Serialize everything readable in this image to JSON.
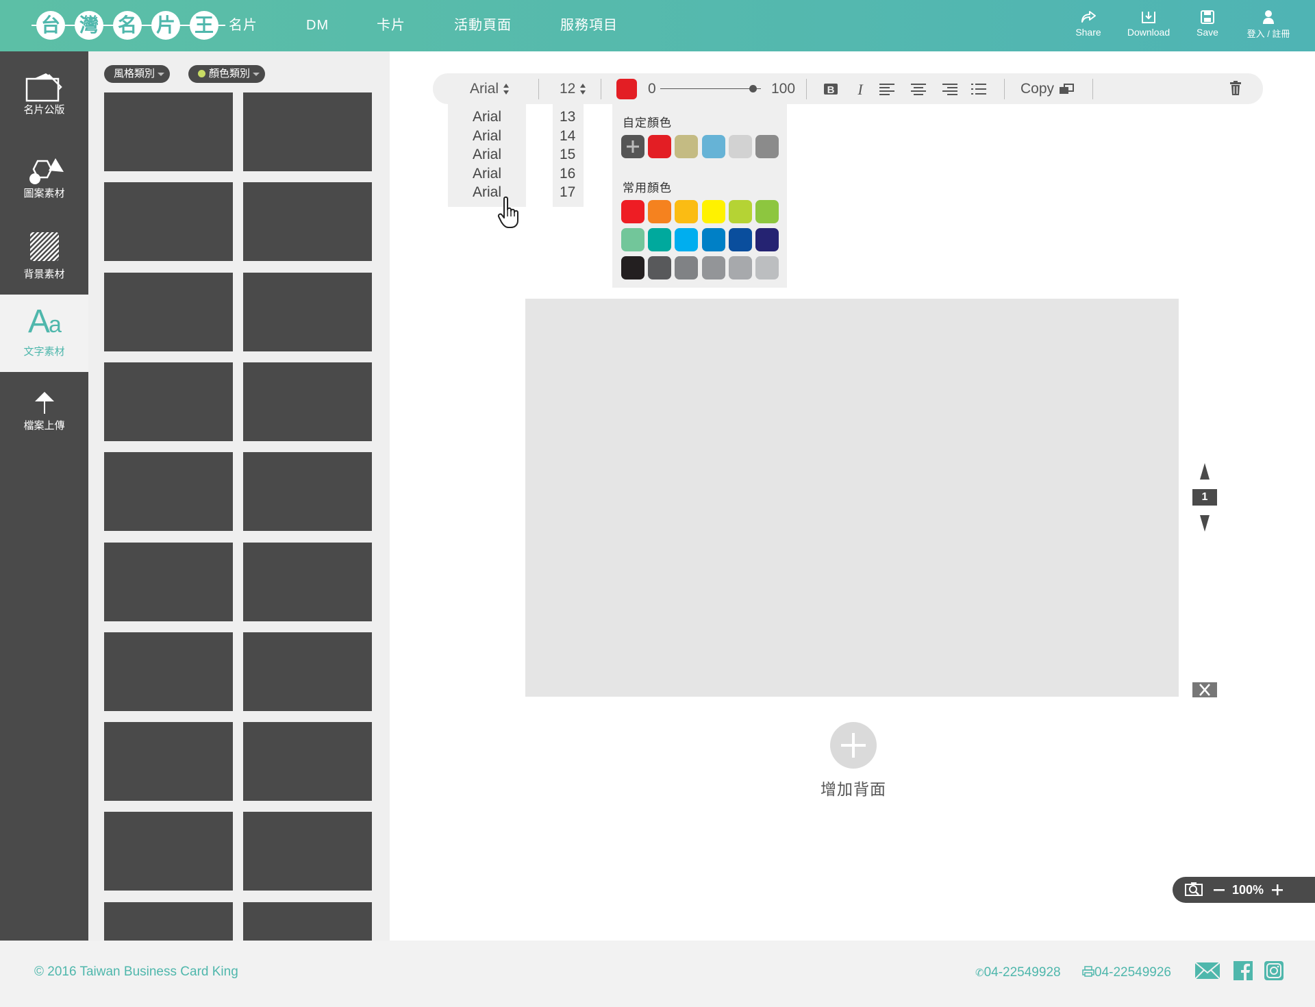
{
  "header": {
    "logo_chars": [
      "台",
      "灣",
      "名",
      "片",
      "王"
    ],
    "nav": [
      "名片",
      "DM",
      "卡片",
      "活動頁面",
      "服務項目"
    ],
    "actions": {
      "share": "Share",
      "download": "Download",
      "save": "Save",
      "login": "登入 / 註冊"
    }
  },
  "sidebar": {
    "items": [
      {
        "label": "名片公版",
        "icon": "card-template-icon"
      },
      {
        "label": "圖案素材",
        "icon": "shapes-icon"
      },
      {
        "label": "背景素材",
        "icon": "background-pattern-icon"
      },
      {
        "label": "文字素材",
        "icon": "text-aa-icon",
        "active": true
      },
      {
        "label": "檔案上傳",
        "icon": "upload-arrow-icon"
      }
    ]
  },
  "panel": {
    "style_filter": "風格類別",
    "color_filter": "顏色類別",
    "thumbnail_count": 20
  },
  "toolbar": {
    "font": "Arial",
    "size": "12",
    "color": "#e31e24",
    "opacity_min": "0",
    "opacity_max": "100",
    "copy_label": "Copy"
  },
  "font_dropdown": [
    "Arial",
    "Arial",
    "Arial",
    "Arial",
    "Arial"
  ],
  "size_dropdown": [
    "13",
    "14",
    "15",
    "16",
    "17"
  ],
  "color_popup": {
    "custom_title": "自定顏色",
    "custom_colors": [
      "#e31e24",
      "#c4bb83",
      "#66b3d6",
      "#d2d2d2",
      "#8b8b8b"
    ],
    "common_title": "常用顏色",
    "common_colors": [
      "#ee1d24",
      "#f5821f",
      "#fbbc13",
      "#fff200",
      "#b5d334",
      "#8dc63f",
      "#72c69a",
      "#00a99d",
      "#00aeef",
      "#0080c6",
      "#0a4e9d",
      "#252372",
      "#231f20",
      "#58595b",
      "#808285",
      "#939598",
      "#a7a9ac",
      "#bcbec0"
    ]
  },
  "canvas": {
    "page_number": "1",
    "add_back_label": "增加背面"
  },
  "zoom": {
    "level": "100%"
  },
  "footer": {
    "copyright": "2016 Taiwan Business Card King",
    "phone": "04-22549928",
    "fax": "04-22549926"
  }
}
